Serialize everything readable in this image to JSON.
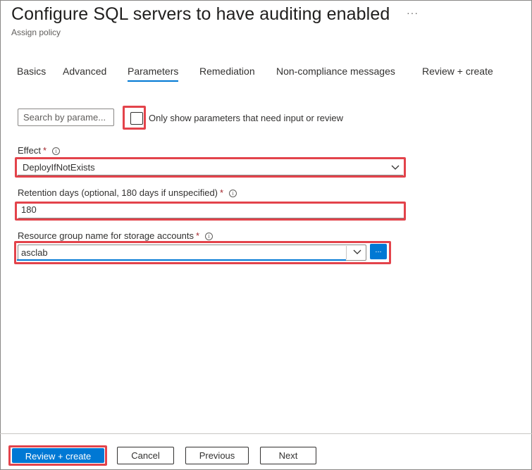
{
  "header": {
    "title": "Configure SQL servers to have auditing enabled",
    "subtitle": "Assign policy",
    "more_label": "···"
  },
  "tabs": [
    {
      "label": "Basics",
      "active": false
    },
    {
      "label": "Advanced",
      "active": false
    },
    {
      "label": "Parameters",
      "active": true
    },
    {
      "label": "Remediation",
      "active": false
    },
    {
      "label": "Non-compliance messages",
      "active": false
    },
    {
      "label": "Review + create",
      "active": false
    }
  ],
  "filter": {
    "search_placeholder": "Search by parame...",
    "checkbox_label": "Only show parameters that need input or review",
    "checkbox_checked": false
  },
  "fields": {
    "effect": {
      "label": "Effect",
      "required_mark": "*",
      "info_icon": "i",
      "value": "DeployIfNotExists"
    },
    "retention": {
      "label": "Retention days (optional, 180 days if unspecified)",
      "required_mark": "*",
      "info_icon": "i",
      "value": "180"
    },
    "resource_group": {
      "label": "Resource group name for storage accounts",
      "required_mark": "*",
      "info_icon": "i",
      "value": "asclab",
      "browse_label": "..."
    }
  },
  "footer": {
    "review_create": "Review + create",
    "cancel": "Cancel",
    "previous": "Previous",
    "next": "Next"
  },
  "colors": {
    "accent": "#0078d4",
    "highlight": "#e3434b",
    "required": "#a4262c"
  }
}
